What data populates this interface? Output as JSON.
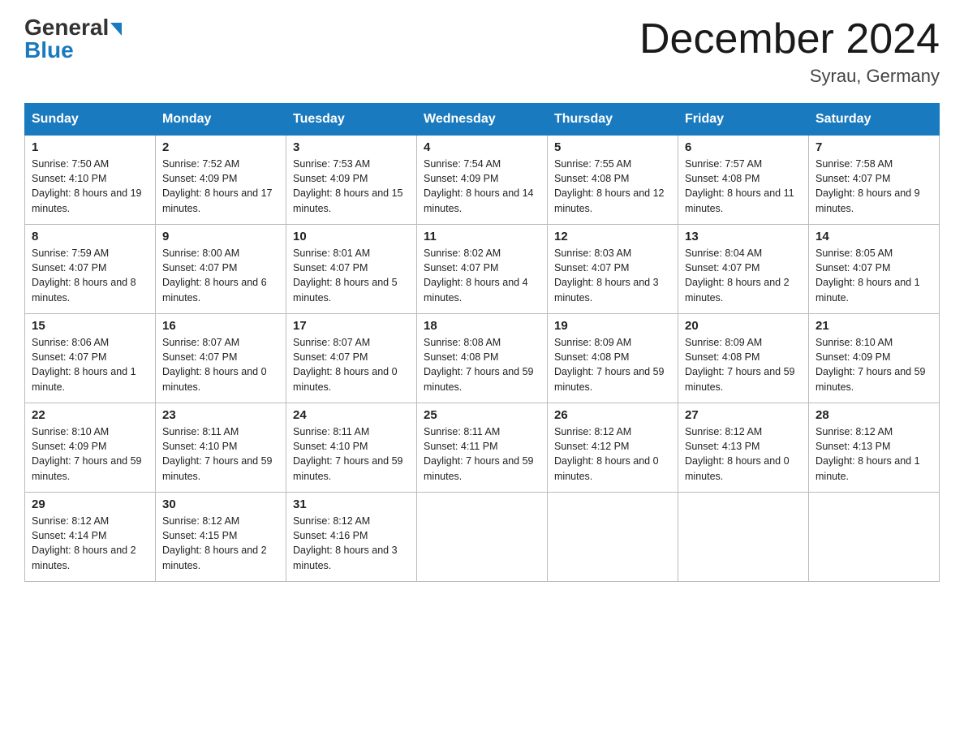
{
  "header": {
    "logo_general": "General",
    "logo_blue": "Blue",
    "month_title": "December 2024",
    "location": "Syrau, Germany"
  },
  "days_of_week": [
    "Sunday",
    "Monday",
    "Tuesday",
    "Wednesday",
    "Thursday",
    "Friday",
    "Saturday"
  ],
  "weeks": [
    [
      {
        "day": 1,
        "sunrise": "7:50 AM",
        "sunset": "4:10 PM",
        "daylight": "8 hours and 19 minutes."
      },
      {
        "day": 2,
        "sunrise": "7:52 AM",
        "sunset": "4:09 PM",
        "daylight": "8 hours and 17 minutes."
      },
      {
        "day": 3,
        "sunrise": "7:53 AM",
        "sunset": "4:09 PM",
        "daylight": "8 hours and 15 minutes."
      },
      {
        "day": 4,
        "sunrise": "7:54 AM",
        "sunset": "4:09 PM",
        "daylight": "8 hours and 14 minutes."
      },
      {
        "day": 5,
        "sunrise": "7:55 AM",
        "sunset": "4:08 PM",
        "daylight": "8 hours and 12 minutes."
      },
      {
        "day": 6,
        "sunrise": "7:57 AM",
        "sunset": "4:08 PM",
        "daylight": "8 hours and 11 minutes."
      },
      {
        "day": 7,
        "sunrise": "7:58 AM",
        "sunset": "4:07 PM",
        "daylight": "8 hours and 9 minutes."
      }
    ],
    [
      {
        "day": 8,
        "sunrise": "7:59 AM",
        "sunset": "4:07 PM",
        "daylight": "8 hours and 8 minutes."
      },
      {
        "day": 9,
        "sunrise": "8:00 AM",
        "sunset": "4:07 PM",
        "daylight": "8 hours and 6 minutes."
      },
      {
        "day": 10,
        "sunrise": "8:01 AM",
        "sunset": "4:07 PM",
        "daylight": "8 hours and 5 minutes."
      },
      {
        "day": 11,
        "sunrise": "8:02 AM",
        "sunset": "4:07 PM",
        "daylight": "8 hours and 4 minutes."
      },
      {
        "day": 12,
        "sunrise": "8:03 AM",
        "sunset": "4:07 PM",
        "daylight": "8 hours and 3 minutes."
      },
      {
        "day": 13,
        "sunrise": "8:04 AM",
        "sunset": "4:07 PM",
        "daylight": "8 hours and 2 minutes."
      },
      {
        "day": 14,
        "sunrise": "8:05 AM",
        "sunset": "4:07 PM",
        "daylight": "8 hours and 1 minute."
      }
    ],
    [
      {
        "day": 15,
        "sunrise": "8:06 AM",
        "sunset": "4:07 PM",
        "daylight": "8 hours and 1 minute."
      },
      {
        "day": 16,
        "sunrise": "8:07 AM",
        "sunset": "4:07 PM",
        "daylight": "8 hours and 0 minutes."
      },
      {
        "day": 17,
        "sunrise": "8:07 AM",
        "sunset": "4:07 PM",
        "daylight": "8 hours and 0 minutes."
      },
      {
        "day": 18,
        "sunrise": "8:08 AM",
        "sunset": "4:08 PM",
        "daylight": "7 hours and 59 minutes."
      },
      {
        "day": 19,
        "sunrise": "8:09 AM",
        "sunset": "4:08 PM",
        "daylight": "7 hours and 59 minutes."
      },
      {
        "day": 20,
        "sunrise": "8:09 AM",
        "sunset": "4:08 PM",
        "daylight": "7 hours and 59 minutes."
      },
      {
        "day": 21,
        "sunrise": "8:10 AM",
        "sunset": "4:09 PM",
        "daylight": "7 hours and 59 minutes."
      }
    ],
    [
      {
        "day": 22,
        "sunrise": "8:10 AM",
        "sunset": "4:09 PM",
        "daylight": "7 hours and 59 minutes."
      },
      {
        "day": 23,
        "sunrise": "8:11 AM",
        "sunset": "4:10 PM",
        "daylight": "7 hours and 59 minutes."
      },
      {
        "day": 24,
        "sunrise": "8:11 AM",
        "sunset": "4:10 PM",
        "daylight": "7 hours and 59 minutes."
      },
      {
        "day": 25,
        "sunrise": "8:11 AM",
        "sunset": "4:11 PM",
        "daylight": "7 hours and 59 minutes."
      },
      {
        "day": 26,
        "sunrise": "8:12 AM",
        "sunset": "4:12 PM",
        "daylight": "8 hours and 0 minutes."
      },
      {
        "day": 27,
        "sunrise": "8:12 AM",
        "sunset": "4:13 PM",
        "daylight": "8 hours and 0 minutes."
      },
      {
        "day": 28,
        "sunrise": "8:12 AM",
        "sunset": "4:13 PM",
        "daylight": "8 hours and 1 minute."
      }
    ],
    [
      {
        "day": 29,
        "sunrise": "8:12 AM",
        "sunset": "4:14 PM",
        "daylight": "8 hours and 2 minutes."
      },
      {
        "day": 30,
        "sunrise": "8:12 AM",
        "sunset": "4:15 PM",
        "daylight": "8 hours and 2 minutes."
      },
      {
        "day": 31,
        "sunrise": "8:12 AM",
        "sunset": "4:16 PM",
        "daylight": "8 hours and 3 minutes."
      },
      null,
      null,
      null,
      null
    ]
  ]
}
